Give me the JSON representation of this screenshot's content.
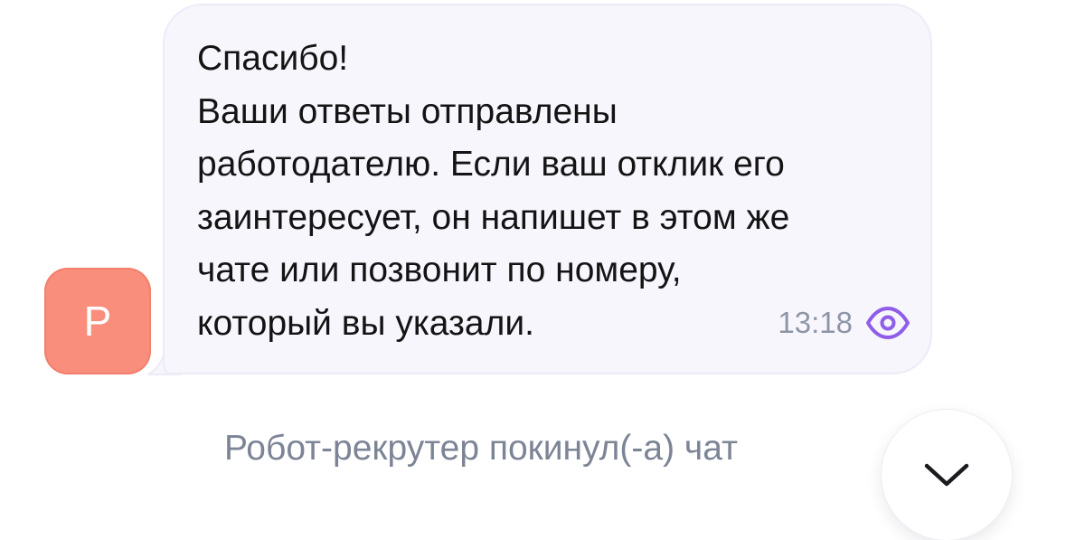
{
  "chat": {
    "avatar": {
      "initial": "Р",
      "color": "#fa8e7c"
    },
    "message": {
      "lines": [
        "Спасибо!",
        "Ваши ответы отправлены",
        "работодателю. Если ваш отклик его",
        "заинтересует, он напишет в этом же",
        "чате или позвонит по номеру,",
        "который вы указали."
      ],
      "time": "13:18",
      "read_icon": "eye-icon",
      "read_icon_color": "#8f5de8",
      "bubble_color": "#f7f6fd"
    },
    "system_note": "Робот-рекрутер покинул(-а) чат",
    "scroll_button": {
      "icon": "chevron-down-icon"
    }
  }
}
